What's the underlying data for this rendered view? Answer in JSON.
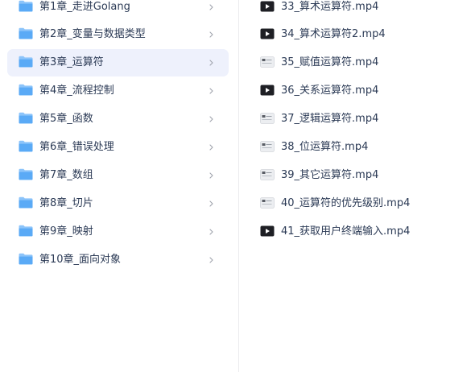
{
  "folders": [
    {
      "label": "第1章_走进Golang",
      "selected": false
    },
    {
      "label": "第2章_变量与数据类型",
      "selected": false
    },
    {
      "label": "第3章_运算符",
      "selected": true
    },
    {
      "label": "第4章_流程控制",
      "selected": false
    },
    {
      "label": "第5章_函数",
      "selected": false
    },
    {
      "label": "第6章_错误处理",
      "selected": false
    },
    {
      "label": "第7章_数组",
      "selected": false
    },
    {
      "label": "第8章_切片",
      "selected": false
    },
    {
      "label": "第9章_映射",
      "selected": false
    },
    {
      "label": "第10章_面向对象",
      "selected": false
    }
  ],
  "files": [
    {
      "label": "33_算术运算符.mp4",
      "thumb": "dark-video-icon"
    },
    {
      "label": "34_算术运算符2.mp4",
      "thumb": "dark-video-icon"
    },
    {
      "label": "35_赋值运算符.mp4",
      "thumb": "light-video-icon"
    },
    {
      "label": "36_关系运算符.mp4",
      "thumb": "dark-video-icon"
    },
    {
      "label": "37_逻辑运算符.mp4",
      "thumb": "light-video-icon"
    },
    {
      "label": "38_位运算符.mp4",
      "thumb": "light-video-icon"
    },
    {
      "label": "39_其它运算符.mp4",
      "thumb": "light-video-icon"
    },
    {
      "label": "40_运算符的优先级别.mp4",
      "thumb": "light-video-icon"
    },
    {
      "label": "41_获取用户终端输入.mp4",
      "thumb": "dark-video-icon"
    }
  ],
  "colors": {
    "folder": "#5aaaf6",
    "selected_bg": "#eef1fc",
    "text": "#2b3a55"
  }
}
